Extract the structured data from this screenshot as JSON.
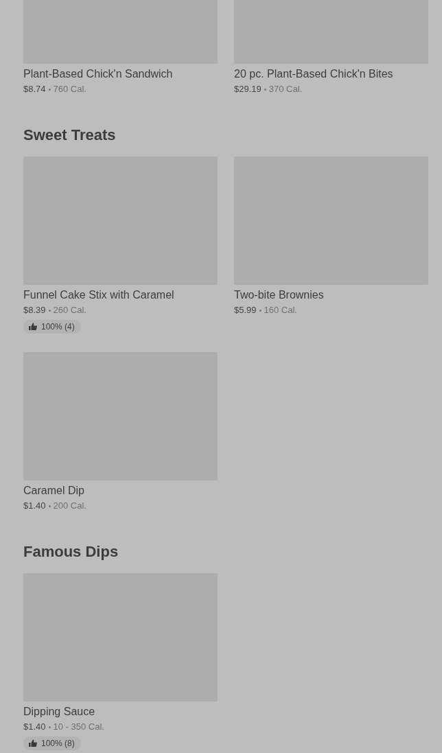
{
  "sections": [
    {
      "items": [
        {
          "name": "Plant-Based Chick'n Sandwich",
          "price": "$8.74",
          "calories": "760 Cal."
        },
        {
          "name": "20 pc. Plant-Based Chick'n Bites",
          "price": "$29.19",
          "calories": "370 Cal."
        }
      ]
    },
    {
      "title": "Sweet Treats",
      "items": [
        {
          "name": "Funnel Cake Stix with Caramel",
          "price": "$8.39",
          "calories": "260 Cal.",
          "rating": "100% (4)"
        },
        {
          "name": "Two-bite Brownies",
          "price": "$5.99",
          "calories": "160 Cal."
        },
        {
          "name": "Caramel Dip",
          "price": "$1.40",
          "calories": "200 Cal."
        }
      ]
    },
    {
      "title": "Famous Dips",
      "items": [
        {
          "name": "Dipping Sauce",
          "price": "$1.40",
          "calories": "10 - 350 Cal.",
          "rating": "100% (8)"
        }
      ]
    }
  ]
}
